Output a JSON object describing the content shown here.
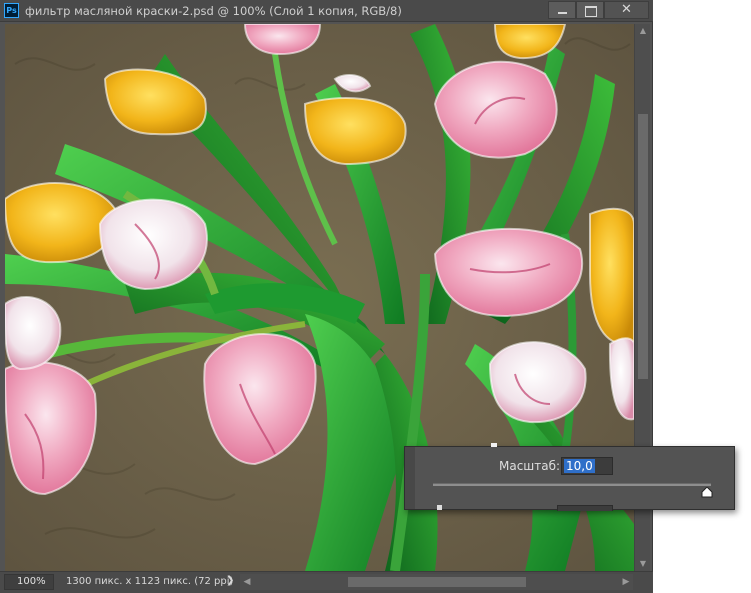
{
  "window": {
    "title": "фильтр масляной краски-2.psd @ 100% (Слой 1 копия, RGB/8)",
    "app_icon": "Ps",
    "controls": [
      "minimize-icon",
      "maximize-icon",
      "close-icon"
    ]
  },
  "canvas": {
    "subject": "oil-paint tulips image"
  },
  "statusbar": {
    "zoom": "100%",
    "doc_size": "1300 пикс. x 1123 пикс. (72 ppi)",
    "expand_arrow": "❯"
  },
  "filter_panel": {
    "scale_label": "Масштаб:",
    "scale_value": "10,0",
    "slider_level": 1.0
  },
  "colors": {
    "chrome": "#535353",
    "titlebar": "#4a4a4a",
    "selection": "#2f6fc9",
    "ps_accent": "#31a8ff"
  }
}
